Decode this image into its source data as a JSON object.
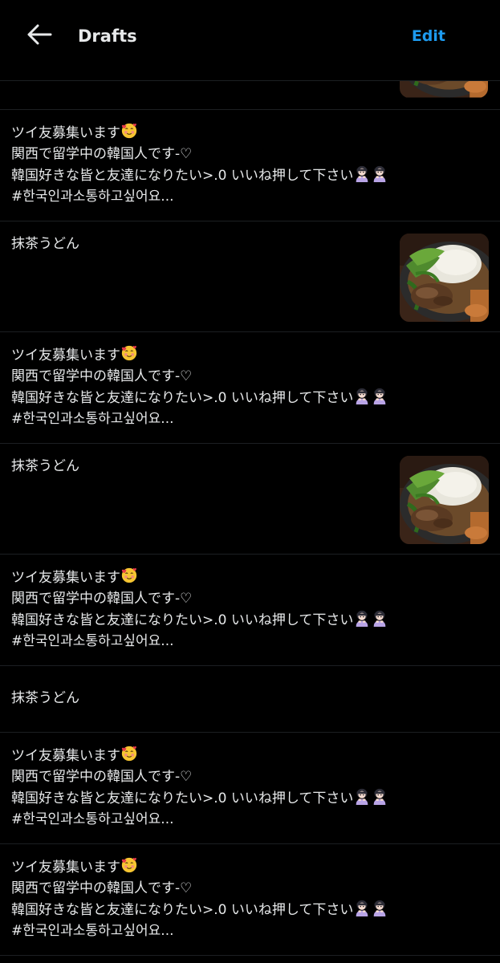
{
  "header": {
    "title": "Drafts",
    "edit_label": "Edit",
    "back_icon": "arrow-left-icon"
  },
  "colors": {
    "background": "#000000",
    "text": "#e7e9ea",
    "accent": "#1d9bf0",
    "divider": "#1c1f22"
  },
  "drafts": [
    {
      "line1": "ツイ友募集います",
      "line2": "関西で留学中の韓国人です-♡",
      "line3": "韓国好きな皆と友達になりたい>.0 いいね押して下さい",
      "line4": "#한국인과소통하고싶어요..."
    },
    {
      "text": "抹茶うどん",
      "has_image": true
    },
    {
      "line1": "ツイ友募集います",
      "line2": "関西で留学中の韓国人です-♡",
      "line3": "韓国好きな皆と友達になりたい>.0 いいね押して下さい",
      "line4": "#한국인과소통하고싶어요..."
    },
    {
      "text": "抹茶うどん",
      "has_image": true
    },
    {
      "line1": "ツイ友募集います",
      "line2": "関西で留学中の韓国人です-♡",
      "line3": "韓国好きな皆と友達になりたい>.0 いいね押して下さい",
      "line4": "#한국인과소통하고싶어요..."
    },
    {
      "text": "抹茶うどん",
      "has_image": false
    },
    {
      "line1": "ツイ友募集います",
      "line2": "関西で留学中の韓国人です-♡",
      "line3": "韓国好きな皆と友達になりたい>.0 いいね押して下さい",
      "line4": "#한국인과소통하고싶어요..."
    },
    {
      "line1": "ツイ友募集います",
      "line2": "関西で留学中の韓国人です-♡",
      "line3": "韓国好きな皆と友達になりたい>.0 いいね押して下さい",
      "line4": "#한국인과소통하고싶어요..."
    }
  ]
}
